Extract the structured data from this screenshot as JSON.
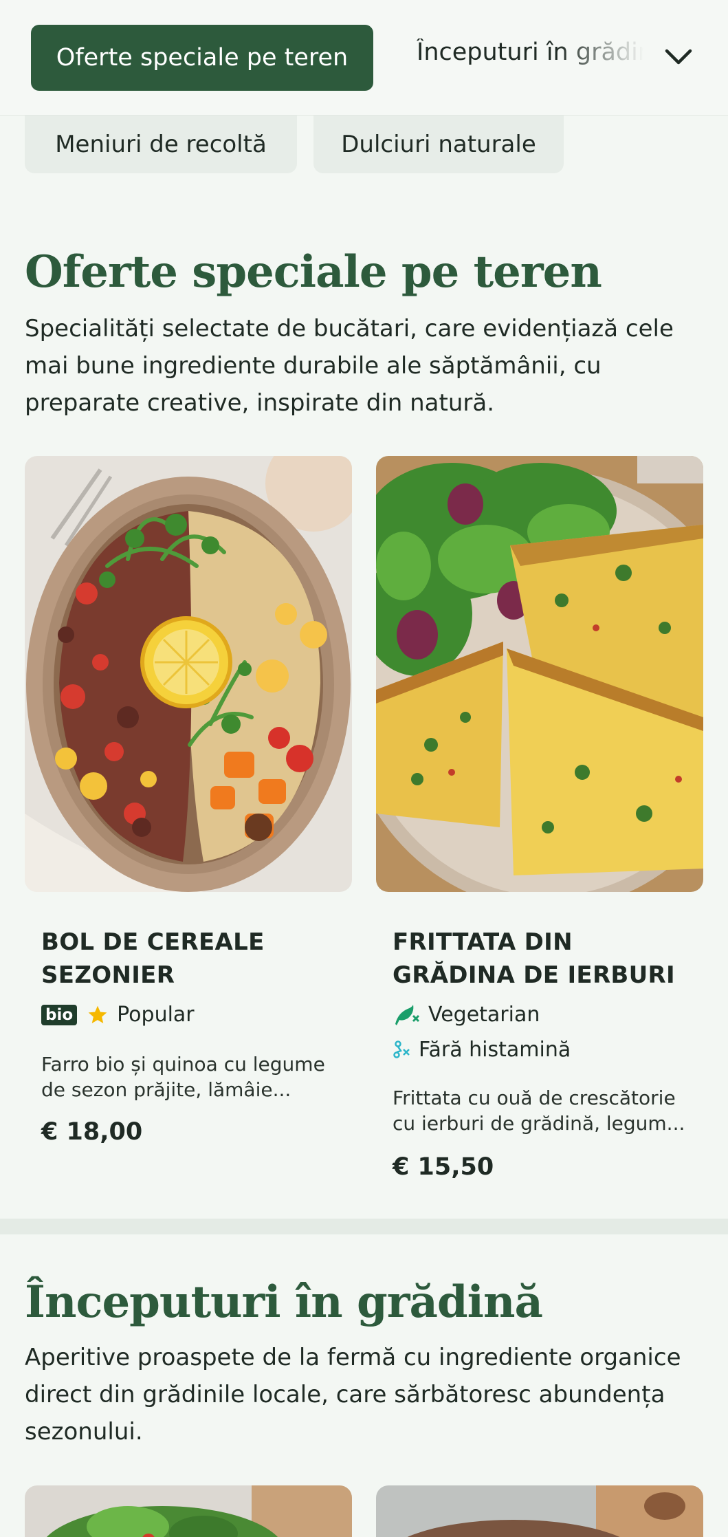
{
  "nav": {
    "active_tab": "Oferte speciale pe teren",
    "next_tab": "Începuturi în grădină",
    "chips": [
      "Meniuri de recoltă",
      "Dulciuri naturale"
    ]
  },
  "section_specials": {
    "title": "Oferte speciale pe teren",
    "description": "Specialități selectate de bucătari, care evidențiază cele mai bune ingrediente durabile ale săptămânii, cu preparate creative, inspirate din natură.",
    "items": [
      {
        "name": "BOL DE CEREALE SEZONIER",
        "badge": "bio",
        "tag": "Popular",
        "description": "Farro bio și quinoa cu legume de sezon prăjite, lămâie...",
        "price": "€ 18,00"
      },
      {
        "name": "FRITTATA DIN GRĂDINA DE IERBURI",
        "tags": [
          "Vegetarian",
          "Fără histamină"
        ],
        "description": "Frittata cu ouă de crescătorie cu ierburi de grădină, legum...",
        "price": "€ 15,50"
      }
    ]
  },
  "section_starters": {
    "title": "Începuturi în grădină",
    "description": "Aperitive proaspete de la fermă cu ingrediente organice direct din grădinile locale, care sărbătoresc abundența sezonului."
  },
  "colors": {
    "brand_green": "#2d5a3c",
    "background": "#f3f7f3",
    "star": "#f5b800",
    "veg_icon": "#1a9e6a",
    "histamine_icon": "#2bb5c9"
  }
}
